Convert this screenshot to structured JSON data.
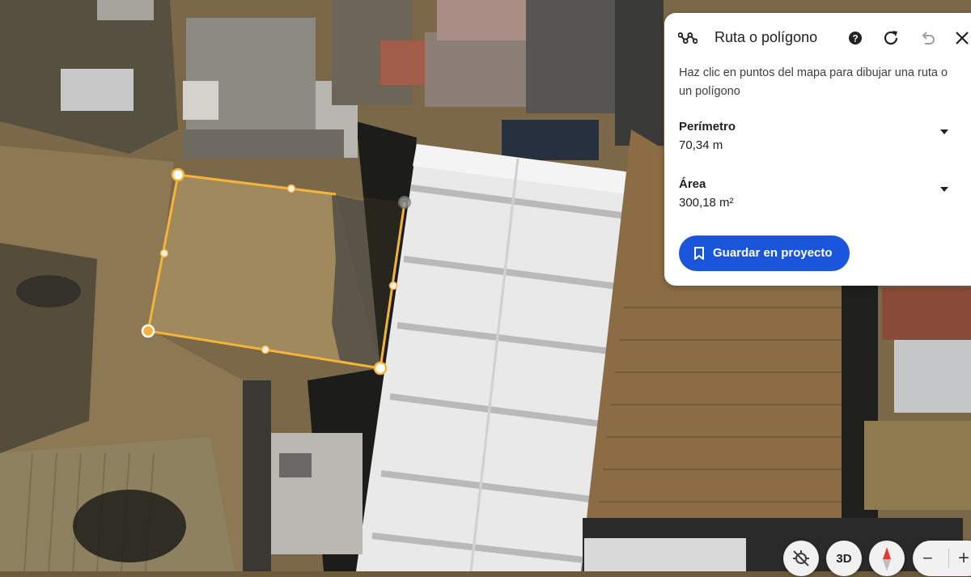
{
  "panel": {
    "title": "Ruta o polígono",
    "instructions": "Haz clic en puntos del mapa para dibujar una ruta o un polígono",
    "icons": {
      "path": "polyline-icon",
      "help": "help-icon",
      "refresh": "refresh-icon",
      "undo": "undo-icon",
      "close": "close-icon"
    },
    "perimeter": {
      "label": "Perímetro",
      "value": "70,34 m"
    },
    "area": {
      "label": "Área",
      "value": "300,18 m²"
    },
    "save_label": "Guardar en proyecto"
  },
  "controls": {
    "three_d_label": "3D",
    "zoom_out": "−",
    "zoom_in": "+",
    "icons": [
      "north-up-icon",
      "compass-icon"
    ]
  },
  "colors": {
    "accent": "#1a56db",
    "polygon_stroke": "#f4b43c",
    "panel_bg": "#ffffff"
  }
}
